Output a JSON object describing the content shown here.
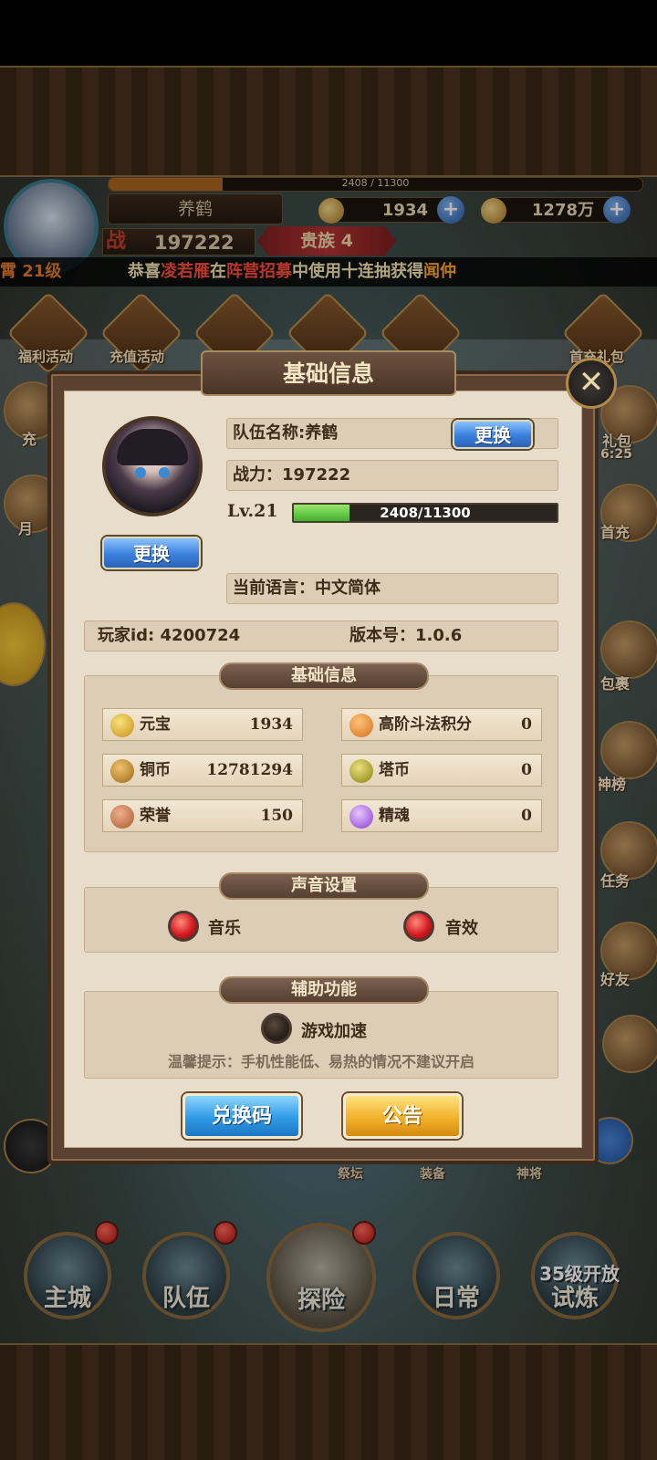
{
  "hud": {
    "exp_text": "2408 / 11300",
    "exp_progress": 0.213,
    "player_name": "养鹤",
    "gold_ingot": "1934",
    "copper": "1278万",
    "power_badge": "战",
    "power": "197222",
    "noble": "贵族 4"
  },
  "marquee": {
    "left_fragment": "霄   21级",
    "prefix": "恭喜",
    "name": "凌若雁",
    "mid1": "在",
    "place": "阵营招募",
    "mid2": "中使用十连抽获得",
    "reward": "闻仲"
  },
  "activities": [
    "福利活动",
    "充值活动",
    "首充礼包"
  ],
  "side_labels": {
    "right": [
      "礼包",
      "首充",
      "包裹",
      "神榜",
      "任务",
      "好友"
    ],
    "right_timer": "6:25",
    "left": [
      "充",
      "月"
    ]
  },
  "under_modal": [
    "祭坛",
    "装备",
    "神将"
  ],
  "nav": {
    "items": [
      "主城",
      "队伍",
      "探险",
      "日常",
      "试炼"
    ],
    "lock_text": "35级开放"
  },
  "modal": {
    "title": "基础信息",
    "close_glyph": "✕",
    "team_name_label": "队伍名称:养鹤",
    "change_name_btn": "更换",
    "power_label": "战力：197222",
    "level_label": "Lv.21",
    "level_text": "2408/11300",
    "level_progress": 0.213,
    "avatar_change_btn": "更换",
    "language_label": "当前语言：中文简体",
    "player_id_label": "玩家id: 4200724",
    "version_label": "版本号：1.0.6",
    "basic_section_title": "基础信息",
    "resources": [
      {
        "name": "元宝",
        "value": "1934",
        "icon": "gold-ingot-icon",
        "color": "#e8b63a"
      },
      {
        "name": "高阶斗法积分",
        "value": "0",
        "icon": "orange-medal-icon",
        "color": "#e58a2c"
      },
      {
        "name": "铜币",
        "value": "12781294",
        "icon": "copper-coin-icon",
        "color": "#c9903a"
      },
      {
        "name": "塔币",
        "value": "0",
        "icon": "tower-coin-icon",
        "color": "#b6a830"
      },
      {
        "name": "荣誉",
        "value": "150",
        "icon": "honor-icon",
        "color": "#c87a4a"
      },
      {
        "name": "精魂",
        "value": "0",
        "icon": "soul-icon",
        "color": "#a46ad8"
      }
    ],
    "sound_section_title": "声音设置",
    "music_label": "音乐",
    "sfx_label": "音效",
    "assist_section_title": "辅助功能",
    "speedup_label": "游戏加速",
    "tip": "温馨提示：手机性能低、易热的情况不建议开启",
    "redeem_btn": "兑换码",
    "notice_btn": "公告"
  }
}
